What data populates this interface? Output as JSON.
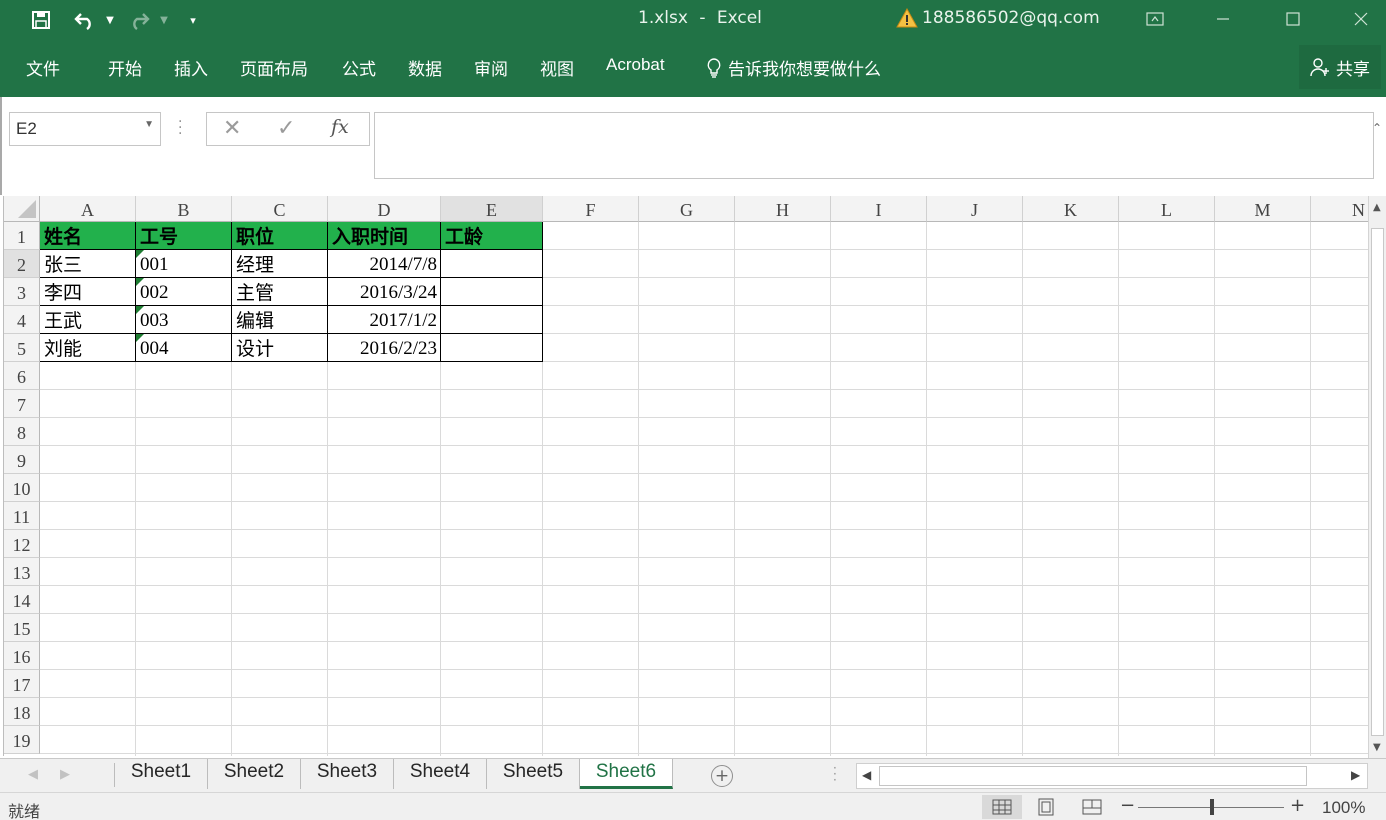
{
  "window": {
    "filename": "1.xlsx",
    "separator": "-",
    "app_name": "Excel",
    "account": "188586502@qq.com",
    "warning_icon": "warning-icon"
  },
  "ribbon": {
    "tabs": [
      "文件",
      "开始",
      "插入",
      "页面布局",
      "公式",
      "数据",
      "审阅",
      "视图",
      "Acrobat"
    ],
    "tell_me": "告诉我你想要做什么",
    "share": "共享"
  },
  "formula_bar": {
    "name_box": "E2",
    "fx_label": "fx",
    "content": ""
  },
  "grid": {
    "columns": [
      "A",
      "B",
      "C",
      "D",
      "E",
      "F",
      "G",
      "H",
      "I",
      "J",
      "K",
      "L",
      "M",
      "N"
    ],
    "rows": [
      "1",
      "2",
      "3",
      "4",
      "5",
      "6",
      "7",
      "8",
      "9",
      "10",
      "11",
      "12",
      "13",
      "14",
      "15",
      "16",
      "17",
      "18",
      "19"
    ],
    "header": [
      "姓名",
      "工号",
      "职位",
      "入职时间",
      "工龄"
    ],
    "data": [
      [
        "张三",
        "001",
        "经理",
        "2014/7/8",
        ""
      ],
      [
        "李四",
        "002",
        "主管",
        "2016/3/24",
        ""
      ],
      [
        "王武",
        "003",
        "编辑",
        "2017/1/2",
        ""
      ],
      [
        "刘能",
        "004",
        "设计",
        "2016/2/23",
        ""
      ]
    ],
    "header_fill": "#22b14c",
    "selected_cell": "E2"
  },
  "sheets": {
    "tabs": [
      "Sheet1",
      "Sheet2",
      "Sheet3",
      "Sheet4",
      "Sheet5",
      "Sheet6"
    ],
    "active": "Sheet6",
    "add_label": "+"
  },
  "status": {
    "text": "就绪",
    "zoom": "100%"
  },
  "colors": {
    "ribbon": "#217346",
    "accent": "#217346"
  }
}
